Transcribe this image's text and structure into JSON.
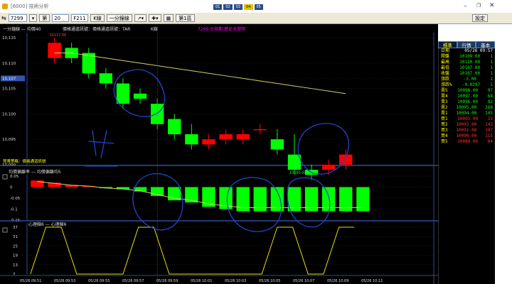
{
  "window": {
    "title": "[6000] 技術分析",
    "buttons": [
      "01",
      "02",
      "03",
      "04",
      "05"
    ],
    "settings_label": "設定"
  },
  "toolbar": {
    "symbol": "7299",
    "period_label": "第",
    "period_value": "20",
    "field2": "F211",
    "kline_label": "K線",
    "interval_label": "一分鐘線",
    "screen_label": "第1區"
  },
  "colors": {
    "up": "#ff0000",
    "down": "#00ff00",
    "axis": "#2a4a9a",
    "ma": "#d4d06a",
    "grid": "#333333"
  },
  "price_panel": {
    "legend": "一分鐘線 — 均價40",
    "legend2": "價格通道訊號：價格通道訊號：TAR",
    "legend3": "K線",
    "headline": "7299 台指期  歷史未發明",
    "y_ticks": [
      "10,115",
      "10,110",
      "10,107",
      "10,105",
      "10,100",
      "10,095",
      "10,090"
    ],
    "price_marker_label": "10,107",
    "high_label": "10117.00",
    "low_label": "10090.00",
    "bottom_note": "買賣策略：價格通道訊號"
  },
  "indicator_panel": {
    "legend": "均價偏離率  — 均價偏離均5",
    "y_ticks": [
      "0.05",
      "0",
      "-0.05",
      "-0.1",
      "-0.15"
    ]
  },
  "psy_panel": {
    "legend": "心理線6 — 心理線6",
    "y_ticks": [
      "37",
      "31",
      "25",
      "19",
      "13",
      "7"
    ]
  },
  "time_axis": [
    "05/26 09:51",
    "05/26 09:53",
    "05/26 09:55",
    "05/26 09:57",
    "05/26 09:59",
    "05/26 10:01",
    "05/26 10:03",
    "05/26 10:05",
    "05/26 10:07",
    "05/26 10:09",
    "05/26 10:11"
  ],
  "right_tabs": [
    "標準",
    "行情",
    "基本"
  ],
  "quote": {
    "date_label": "日期",
    "date_value": "05/26 09:57",
    "rows": [
      {
        "label": "開盤",
        "value": "10109.00",
        "extra": "1"
      },
      {
        "label": "最高",
        "value": "10110.00",
        "extra": "1"
      },
      {
        "label": "最低",
        "value": "10107.00",
        "extra": "1"
      },
      {
        "label": "收盤",
        "value": "10107.00",
        "extra": "1"
      },
      {
        "label": "漲跌",
        "value": "-3.00",
        "extra": "1"
      },
      {
        "label": "漲跌%",
        "value": "-0.0297",
        "extra": "1"
      }
    ],
    "sell_rows": [
      {
        "label": "賣5",
        "value": "10098.00",
        "qty": "97"
      },
      {
        "label": "賣4",
        "value": "10097.00",
        "qty": "68"
      },
      {
        "label": "賣3",
        "value": "10096.00",
        "qty": "92"
      },
      {
        "label": "賣2",
        "value": "10095.00",
        "qty": "268"
      },
      {
        "label": "賣1",
        "value": "10094.00",
        "qty": "145"
      }
    ],
    "buy_rows": [
      {
        "label": "買1",
        "value": "10093.00",
        "qty": "33"
      },
      {
        "label": "買2",
        "value": "10092.00",
        "qty": "143"
      },
      {
        "label": "買3",
        "value": "10091.00",
        "qty": "197"
      },
      {
        "label": "買4",
        "value": "10090.00",
        "qty": "115"
      },
      {
        "label": "買5",
        "value": "10089.00",
        "qty": "84"
      }
    ]
  },
  "candles": [
    {
      "o": 10111,
      "c": 10114,
      "h": 10115,
      "l": 10110
    },
    {
      "o": 10113,
      "c": 10111,
      "h": 10114,
      "l": 10110
    },
    {
      "o": 10112,
      "c": 10108,
      "h": 10113,
      "l": 10107
    },
    {
      "o": 10108,
      "c": 10106,
      "h": 10109,
      "l": 10105
    },
    {
      "o": 10106,
      "c": 10102,
      "h": 10107,
      "l": 10101
    },
    {
      "o": 10104,
      "c": 10103,
      "h": 10105,
      "l": 10102
    },
    {
      "o": 10102,
      "c": 10098,
      "h": 10103,
      "l": 10097
    },
    {
      "o": 10099,
      "c": 10096,
      "h": 10100,
      "l": 10095
    },
    {
      "o": 10096,
      "c": 10094,
      "h": 10098,
      "l": 10093
    },
    {
      "o": 10094,
      "c": 10095,
      "h": 10096,
      "l": 10093
    },
    {
      "o": 10095,
      "c": 10096,
      "h": 10097,
      "l": 10094
    },
    {
      "o": 10095,
      "c": 10096,
      "h": 10097,
      "l": 10094
    },
    {
      "o": 10097,
      "c": 10097,
      "h": 10098,
      "l": 10096
    },
    {
      "o": 10095,
      "c": 10093,
      "h": 10097,
      "l": 10092
    },
    {
      "o": 10092,
      "c": 10089,
      "h": 10096,
      "l": 10088
    },
    {
      "o": 10089,
      "c": 10088,
      "h": 10090,
      "l": 10087
    },
    {
      "o": 10089,
      "c": 10090,
      "h": 10091,
      "l": 10088
    },
    {
      "o": 10090,
      "c": 10092,
      "h": 10093,
      "l": 10089
    }
  ],
  "ma_values": [
    10112,
    10112,
    10111.5,
    10111,
    10110.5,
    10110,
    10109.5,
    10109,
    10108.5,
    10108,
    10107.5,
    10107,
    10106.5,
    10106,
    10105.5,
    10105,
    10104.5,
    10104
  ],
  "dev_values": [
    0.03,
    0.02,
    0.01,
    0.005,
    -0.005,
    -0.01,
    -0.02,
    -0.04,
    -0.06,
    -0.07,
    -0.09,
    -0.1,
    -0.11,
    -0.11,
    -0.11,
    -0.11,
    -0.11,
    -0.11,
    -0.11,
    -0.11
  ],
  "psy_values": [
    7,
    37,
    37,
    7,
    7,
    7,
    7,
    37,
    37,
    7,
    7,
    7,
    7,
    7,
    7,
    7,
    37,
    37,
    7,
    7,
    37,
    37
  ]
}
